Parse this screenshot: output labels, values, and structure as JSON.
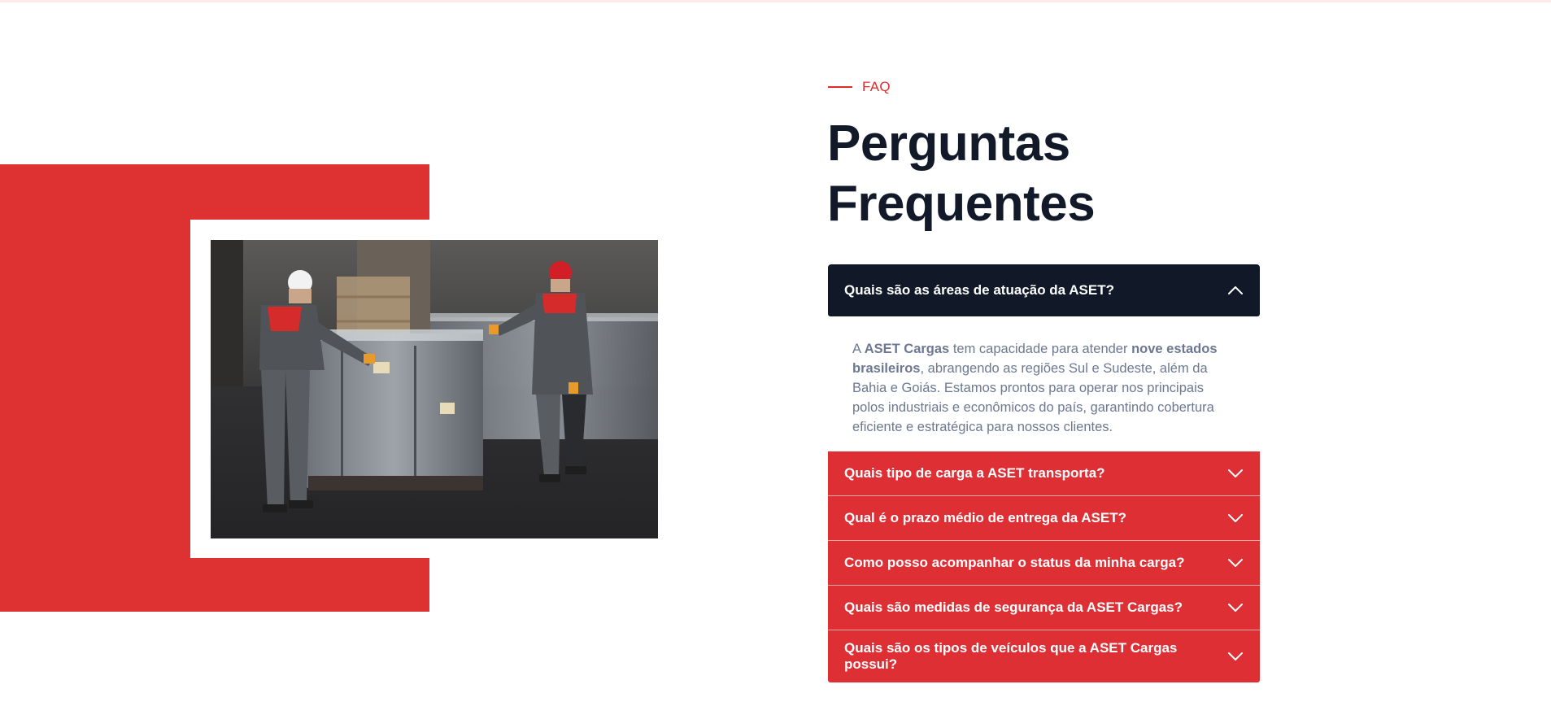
{
  "section": {
    "eyebrow": "FAQ",
    "title_line1": "Perguntas",
    "title_line2": "Frequentes"
  },
  "colors": {
    "accent": "#de3232",
    "dark": "#111827",
    "text_muted": "#6c7892"
  },
  "image": {
    "description": "workers-wrapping-cargo-photo"
  },
  "faq": {
    "open": {
      "question": "Quais são as áreas de atuação da ASET?",
      "answer_parts": {
        "p1": "A ",
        "b1": "ASET Cargas",
        "p2": " tem capacidade para atender ",
        "b2": "nove estados brasileiros",
        "p3": ", abrangendo as regiões Sul e Sudeste, além da Bahia e Goiás. Estamos prontos para operar nos principais polos industriais e econômicos do país, garantindo cobertura eficiente e estratégica para nossos clientes."
      }
    },
    "items": [
      {
        "question": "Quais tipo de carga a ASET transporta?"
      },
      {
        "question": "Qual é o prazo médio de entrega da ASET?"
      },
      {
        "question": "Como posso acompanhar o status da minha carga?"
      },
      {
        "question": "Quais são medidas de segurança da ASET Cargas?"
      },
      {
        "question": "Quais são os tipos de veículos que a ASET Cargas possui?"
      }
    ]
  }
}
